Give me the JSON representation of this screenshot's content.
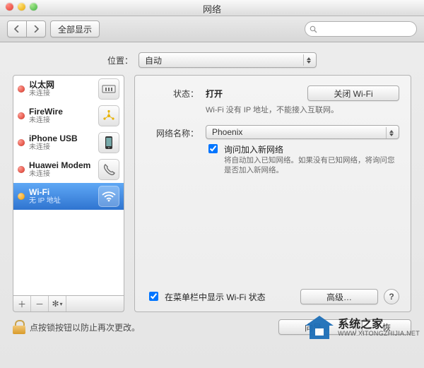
{
  "window": {
    "title": "网络"
  },
  "toolbar": {
    "show_all": "全部显示",
    "search_placeholder": ""
  },
  "location": {
    "label": "位置：",
    "value": "自动"
  },
  "sidebar": {
    "items": [
      {
        "name": "以太网",
        "sub": "未连接",
        "status": "red",
        "icon": "ethernet"
      },
      {
        "name": "FireWire",
        "sub": "未连接",
        "status": "red",
        "icon": "firewire"
      },
      {
        "name": "iPhone USB",
        "sub": "未连接",
        "status": "red",
        "icon": "iphone"
      },
      {
        "name": "Huawei Modem",
        "sub": "未连接",
        "status": "red",
        "icon": "phone"
      },
      {
        "name": "Wi-Fi",
        "sub": "无 IP 地址",
        "status": "orange",
        "icon": "wifi",
        "selected": true
      }
    ]
  },
  "detail": {
    "status_label": "状态：",
    "status_value": "打开",
    "toggle_button": "关闭 Wi-Fi",
    "status_note": "Wi-Fi 没有 IP 地址，不能接入互联网。",
    "network_label": "网络名称：",
    "network_value": "Phoenix",
    "ask_checkbox": "询问加入新网络",
    "ask_note": "将自动加入已知网络。如果没有已知网络，将询问您是否加入新网络。",
    "menubar_checkbox": "在菜单栏中显示 Wi-Fi 状态",
    "advanced_button": "高级…"
  },
  "footer": {
    "lock_text": "点按锁按钮以防止再次更改。",
    "assist_button": "向导…",
    "revert_button": "恢",
    "apply_button": ""
  },
  "watermark": {
    "title": "系统之家",
    "url": "WWW.XITONGZHIJIA.NET"
  }
}
